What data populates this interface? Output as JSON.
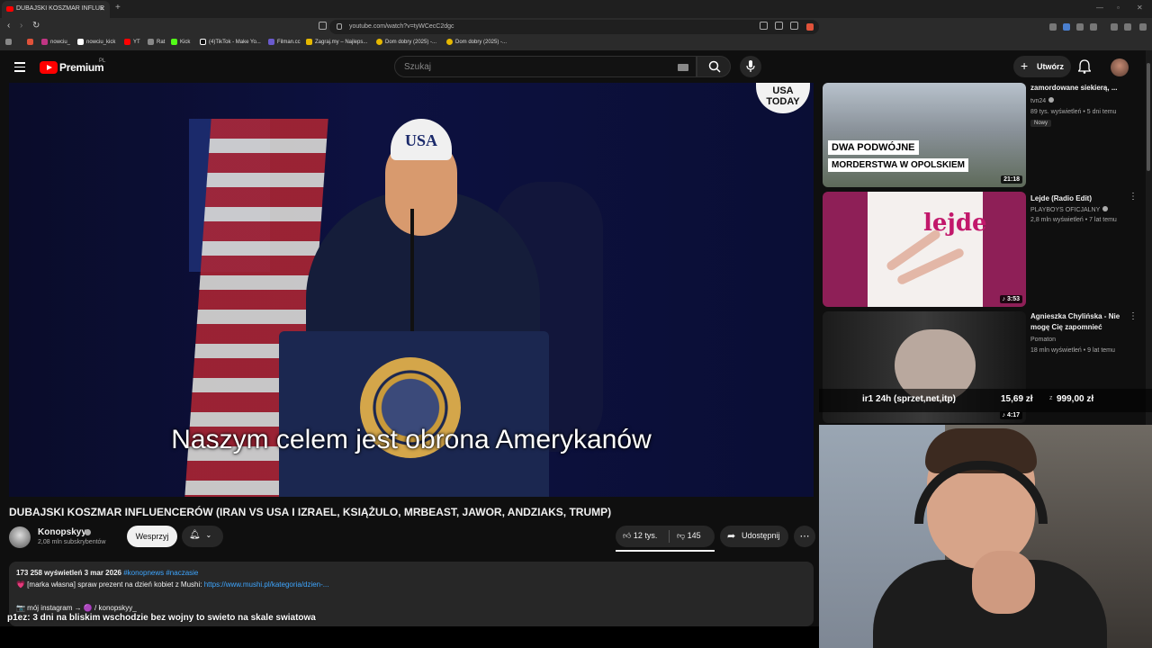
{
  "browser": {
    "tab_title": "DUBAJSKI KOSZMAR INFLUE",
    "url": "youtube.com/watch?v=tyWCecC2dgc",
    "bookmarks": [
      "nowciu_",
      "nowciu_kick",
      "YT",
      "Rat",
      "Kick",
      "(4)TikTok - Make Yo...",
      "Filman.cc",
      "Zagraj.my – Najleps...",
      "Dom dobry (2025) -...",
      "Dom dobry (2025) -..."
    ]
  },
  "header": {
    "logo_text": "Premium",
    "country": "PL",
    "search_placeholder": "Szukaj",
    "create_label": "Utwórz"
  },
  "video": {
    "subtitle": "Naszym celem jest obrona Amerykanów",
    "cap_text": "USA",
    "watermark": "USA\nTODAY",
    "title": "DUBAJSKI KOSZMAR INFLUENCERÓW (IRAN VS USA I IZRAEL, KSIĄŻULO, MRBEAST, JAWOR, ANDZIAKS, TRUMP)"
  },
  "channel": {
    "name": "Konopskyy",
    "subscribers": "2,08 mln subskrybentów",
    "support_label": "Wesprzyj"
  },
  "actions": {
    "likes": "12 tys.",
    "dislikes": "145",
    "share_label": "Udostępnij"
  },
  "description": {
    "views_date": "173 258 wyświetleń  3 mar 2026",
    "tags": "#konopnews #naczasie",
    "line1_prefix": "💗 [marka własna] spraw prezent na dzień kobiet z Mushi: ",
    "line1_link": "https://www.mushi.pl/kategoria/dzien-...",
    "line2": "📷 mój instagram → 🟣 / konopskyy_"
  },
  "overlay": {
    "ticker": "p1ez: 3 dni na bliskim wschodzie bez wojny to swieto na skale swiatowa",
    "donation_text": "ir1 24h (sprzet,net,itp)",
    "donation_amount": "15,69 zł",
    "donation_separator": "z",
    "donation_goal": "999,00 zł"
  },
  "recommendations": [
    {
      "title": "zamordowane siekierą, ...",
      "channel": "tvn24",
      "stats": "89 tys. wyświetleń • 5 dni temu",
      "badge": "Nowy",
      "duration": "21:18",
      "thumb_line1": "DWA PODWÓJNE",
      "thumb_line2": "MORDERSTWA W OPOLSKIEM"
    },
    {
      "title": "Lejde (Radio Edit)",
      "channel": "PLAYBOYS OFICJALNY",
      "stats": "2,8 mln wyświetleń • 7 lat temu",
      "duration": "♪ 3:53",
      "thumb_text": "lejde"
    },
    {
      "title": "Agnieszka Chylińska - Nie mogę Cię zapomnieć",
      "channel": "Pomaton",
      "stats": "18 mln wyświetleń • 9 lat temu",
      "duration": "♪ 4:17"
    }
  ]
}
